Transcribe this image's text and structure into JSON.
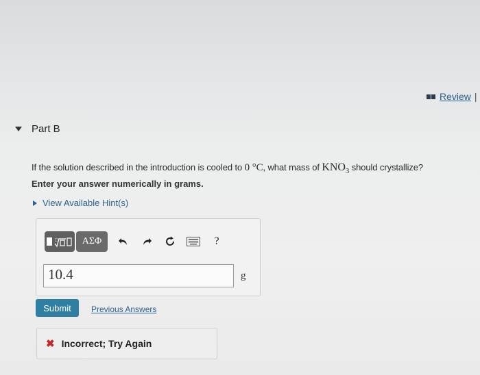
{
  "header": {
    "review_label": "Review",
    "separator": "|"
  },
  "part": {
    "title": "Part B"
  },
  "question": {
    "text_before": "If the solution described in the introduction is cooled to ",
    "temperature": "0 °C",
    "text_middle": ", what mass of ",
    "compound_main": "KNO",
    "compound_sub": "3",
    "text_after": " should crystallize?",
    "instruction": "Enter your answer numerically in grams."
  },
  "hints": {
    "label": "View Available Hint(s)"
  },
  "toolbar": {
    "greek_label": "ΑΣΦ",
    "help_label": "?",
    "icons": [
      "templates-icon",
      "undo-icon",
      "redo-icon",
      "reset-icon",
      "keyboard-icon",
      "help-icon"
    ]
  },
  "answer": {
    "value": "10.4",
    "unit": "g"
  },
  "actions": {
    "submit_label": "Submit",
    "previous_answers_label": "Previous Answers"
  },
  "feedback": {
    "icon": "✖",
    "message": "Incorrect; Try Again"
  },
  "colors": {
    "link": "#2c5f8d",
    "submit_bg": "#2f7fa3",
    "error": "#c0282a"
  }
}
